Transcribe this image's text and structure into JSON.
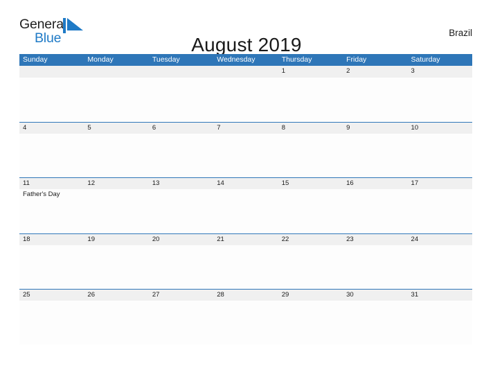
{
  "brand": {
    "name_part1": "General",
    "name_part2": "Blue",
    "flag_icon": "triangle-flag-icon",
    "accent_color": "#1f7ac6"
  },
  "header": {
    "title": "August 2019",
    "region": "Brazil"
  },
  "calendar": {
    "header_bg": "#2e76b8",
    "date_band_bg": "#f0f0f0",
    "weekday_headers": [
      "Sunday",
      "Monday",
      "Tuesday",
      "Wednesday",
      "Thursday",
      "Friday",
      "Saturday"
    ],
    "weeks": [
      {
        "days": [
          {
            "date": "",
            "events": []
          },
          {
            "date": "",
            "events": []
          },
          {
            "date": "",
            "events": []
          },
          {
            "date": "",
            "events": []
          },
          {
            "date": "1",
            "events": []
          },
          {
            "date": "2",
            "events": []
          },
          {
            "date": "3",
            "events": []
          }
        ]
      },
      {
        "days": [
          {
            "date": "4",
            "events": []
          },
          {
            "date": "5",
            "events": []
          },
          {
            "date": "6",
            "events": []
          },
          {
            "date": "7",
            "events": []
          },
          {
            "date": "8",
            "events": []
          },
          {
            "date": "9",
            "events": []
          },
          {
            "date": "10",
            "events": []
          }
        ]
      },
      {
        "days": [
          {
            "date": "11",
            "events": [
              "Father's Day"
            ]
          },
          {
            "date": "12",
            "events": []
          },
          {
            "date": "13",
            "events": []
          },
          {
            "date": "14",
            "events": []
          },
          {
            "date": "15",
            "events": []
          },
          {
            "date": "16",
            "events": []
          },
          {
            "date": "17",
            "events": []
          }
        ]
      },
      {
        "days": [
          {
            "date": "18",
            "events": []
          },
          {
            "date": "19",
            "events": []
          },
          {
            "date": "20",
            "events": []
          },
          {
            "date": "21",
            "events": []
          },
          {
            "date": "22",
            "events": []
          },
          {
            "date": "23",
            "events": []
          },
          {
            "date": "24",
            "events": []
          }
        ]
      },
      {
        "days": [
          {
            "date": "25",
            "events": []
          },
          {
            "date": "26",
            "events": []
          },
          {
            "date": "27",
            "events": []
          },
          {
            "date": "28",
            "events": []
          },
          {
            "date": "29",
            "events": []
          },
          {
            "date": "30",
            "events": []
          },
          {
            "date": "31",
            "events": []
          }
        ]
      }
    ]
  }
}
